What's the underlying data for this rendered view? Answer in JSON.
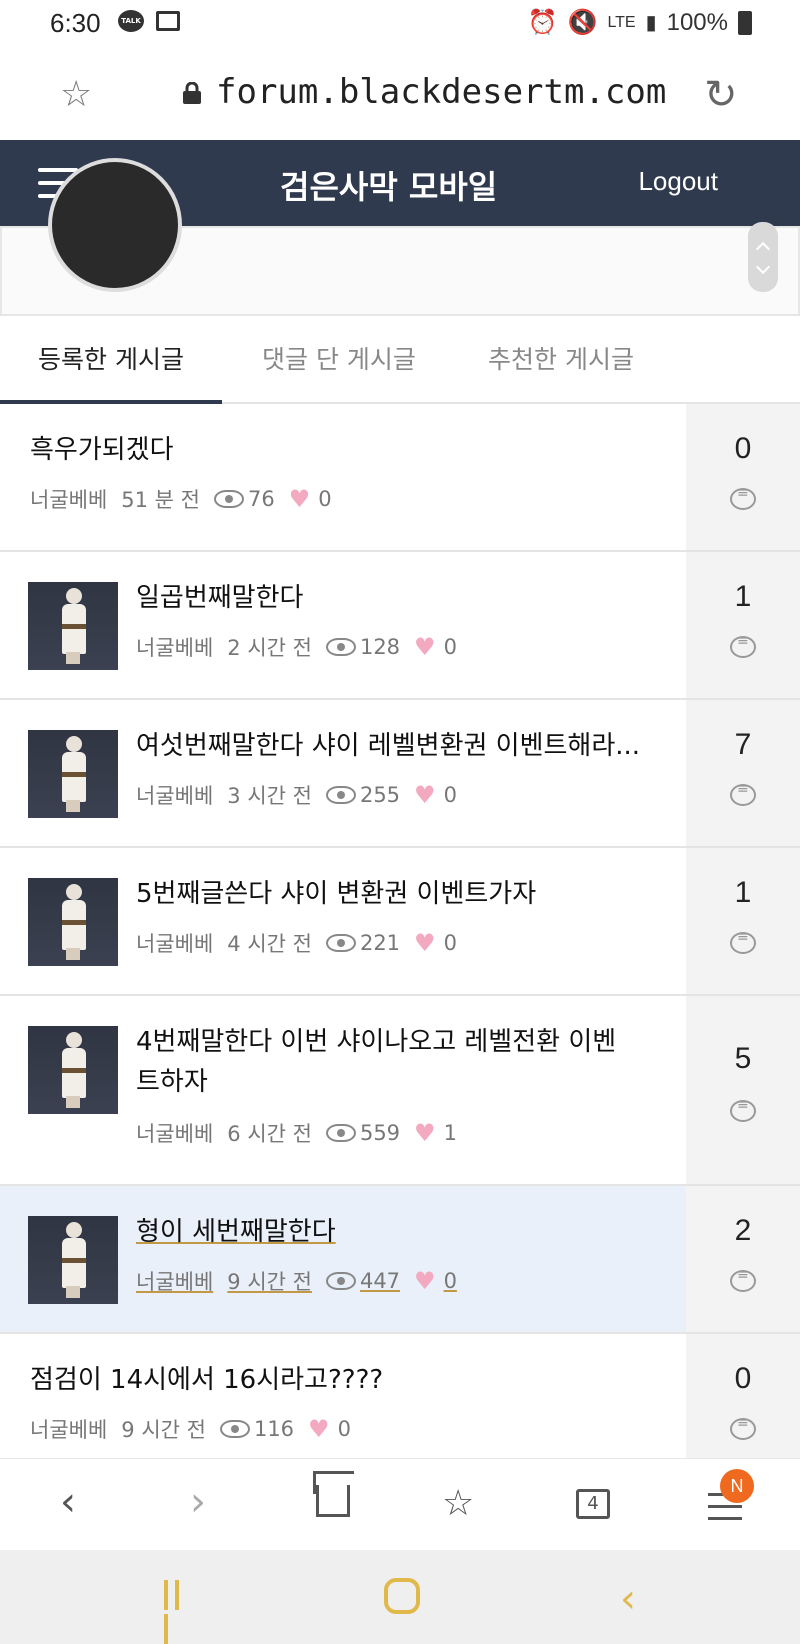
{
  "status_bar": {
    "time": "6:30",
    "talk_badge": "TALK",
    "network": "LTE",
    "battery": "100%"
  },
  "url_bar": {
    "url": "forum.blackdesertm.com"
  },
  "site_header": {
    "logo": "검은사막 모바일",
    "logout_label": "Logout"
  },
  "tabs": [
    {
      "label": "등록한 게시글",
      "active": true
    },
    {
      "label": "댓글 단 게시글",
      "active": false
    },
    {
      "label": "추천한 게시글",
      "active": false
    }
  ],
  "posts": [
    {
      "title": "흑우가되겠다",
      "author": "너굴베베",
      "time": "51 분 전",
      "views": "76",
      "likes": "0",
      "comments": "0",
      "has_thumb": false,
      "highlighted": false
    },
    {
      "title": "일곱번째말한다",
      "author": "너굴베베",
      "time": "2 시간 전",
      "views": "128",
      "likes": "0",
      "comments": "1",
      "has_thumb": true,
      "highlighted": false
    },
    {
      "title": "여섯번째말한다 샤이 레벨변환권 이벤트해라...",
      "author": "너굴베베",
      "time": "3 시간 전",
      "views": "255",
      "likes": "0",
      "comments": "7",
      "has_thumb": true,
      "highlighted": false
    },
    {
      "title": "5번째글쓴다 샤이 변환권 이벤트가자",
      "author": "너굴베베",
      "time": "4 시간 전",
      "views": "221",
      "likes": "0",
      "comments": "1",
      "has_thumb": true,
      "highlighted": false
    },
    {
      "title": "4번째말한다 이번 샤이나오고 레벨전환 이벤트하자",
      "title_line1": "4번째말한다 이번 샤이나오고 레벨전환 이벤",
      "title_line2": "트하자",
      "author": "너굴베베",
      "time": "6 시간 전",
      "views": "559",
      "likes": "1",
      "comments": "5",
      "has_thumb": true,
      "highlighted": false
    },
    {
      "title": "형이 세번째말한다",
      "author": "너굴베베",
      "time": "9 시간 전",
      "views": "447",
      "likes": "0",
      "comments": "2",
      "has_thumb": true,
      "highlighted": true
    },
    {
      "title": "점검이 14시에서 16시라고????",
      "author": "너굴베베",
      "time": "9 시간 전",
      "views": "116",
      "likes": "0",
      "comments": "0",
      "has_thumb": false,
      "highlighted": false
    }
  ],
  "toolbar": {
    "tab_count": "4",
    "badge": "N"
  },
  "icons": {
    "star": "star-icon",
    "lock": "lock-icon",
    "reload": "reload-icon",
    "menu": "hamburger-icon",
    "eye": "eye-icon",
    "heart": "heart-icon",
    "comment": "comment-bubble-icon"
  },
  "colors": {
    "header_bg": "#2f3a4f",
    "highlight_row": "#eaf0fa",
    "heart": "#f3a9bf",
    "badge": "#ef6a1f",
    "nav_accent": "#e0b94a"
  }
}
